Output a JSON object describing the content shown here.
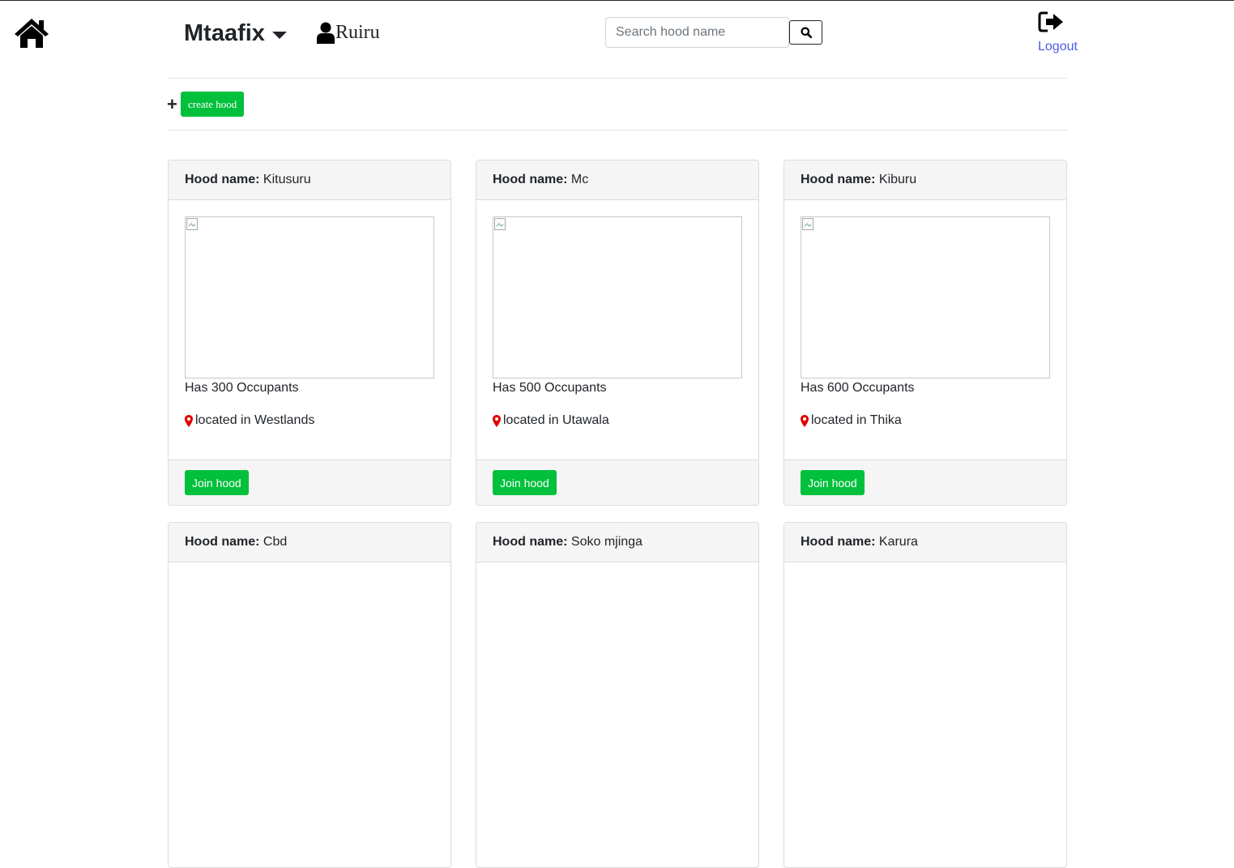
{
  "nav": {
    "brand": "Mtaafix",
    "user": "Ruiru",
    "search_placeholder": "Search hood name",
    "logout": "Logout"
  },
  "actions": {
    "create_label": "create hood",
    "plus": "+"
  },
  "card_labels": {
    "hood_name": "Hood name:",
    "join": "Join hood"
  },
  "hoods": [
    {
      "name": "Kitusuru",
      "occupants": "Has 300 Occupants",
      "location": "located in Westlands"
    },
    {
      "name": "Mc",
      "occupants": "Has 500 Occupants",
      "location": "located in Utawala"
    },
    {
      "name": "Kiburu",
      "occupants": "Has 600 Occupants",
      "location": "located in Thika"
    },
    {
      "name": "Cbd"
    },
    {
      "name": "Soko mjinga"
    },
    {
      "name": "Karura"
    }
  ],
  "colors": {
    "accent": "#00c03c",
    "link": "#4c5be6",
    "pin": "#e00000"
  }
}
